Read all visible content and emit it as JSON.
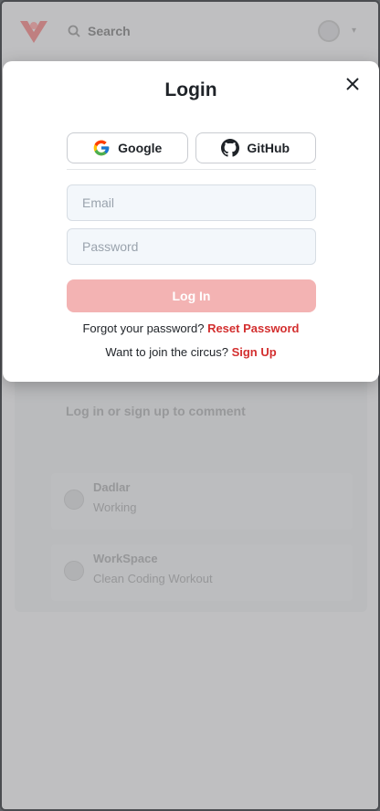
{
  "background": {
    "search_label": "Search",
    "card_title": "Log in or sign up to comment",
    "items": [
      {
        "title": "Dadlar",
        "subtitle": "Working"
      },
      {
        "title": "WorkSpace",
        "subtitle": "Clean Coding Workout"
      }
    ]
  },
  "modal": {
    "title": "Login",
    "close_icon": "close-icon",
    "google_label": "Google",
    "github_label": "GitHub",
    "email_placeholder": "Email",
    "password_placeholder": "Password",
    "login_label": "Log In",
    "forgot_text": "Forgot your password?",
    "reset_link": "Reset Password",
    "join_text": "Want to join the circus?",
    "signup_link": "Sign Up"
  },
  "colors": {
    "accent": "#d32f2f",
    "login_button_disabled": "#f3b3b3",
    "input_bg": "#f3f7fb"
  }
}
